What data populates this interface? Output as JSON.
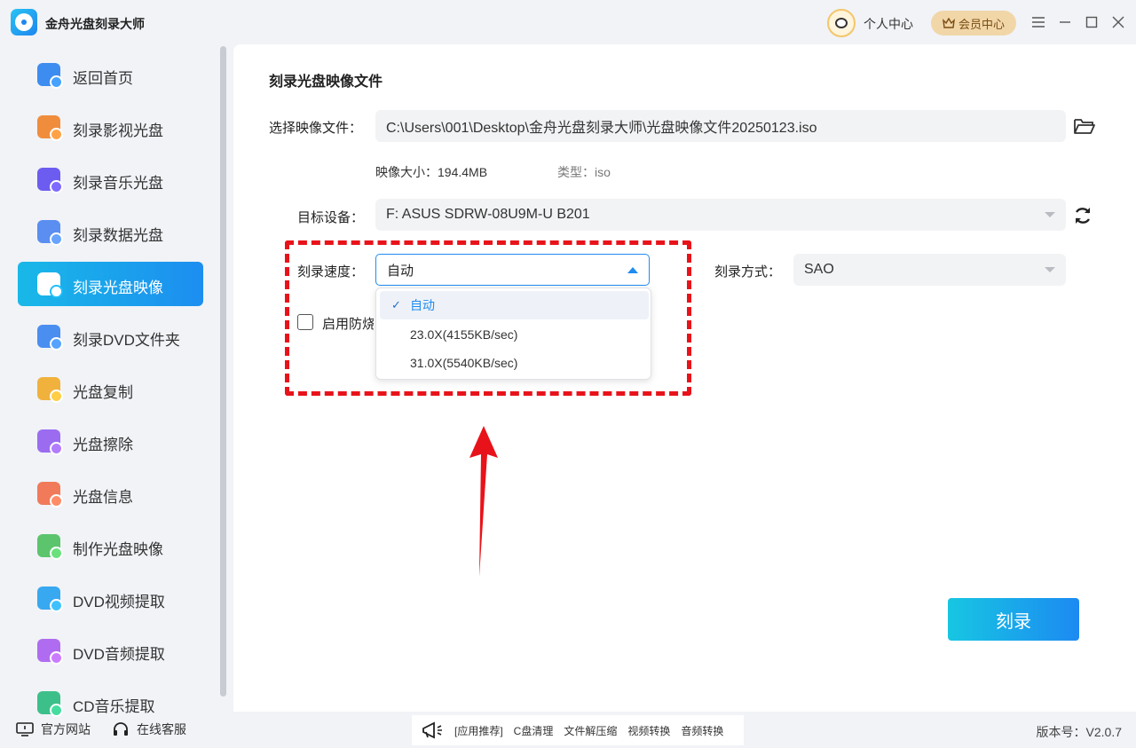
{
  "app": {
    "title": "金舟光盘刻录大师"
  },
  "header": {
    "user_center": "个人中心",
    "vip_center": "会员中心"
  },
  "sidebar": {
    "items": [
      {
        "label": "返回首页",
        "icon": "home-icon",
        "color": "#3d8cf0"
      },
      {
        "label": "刻录影视光盘",
        "icon": "video-disc-icon",
        "color": "#f08d3d"
      },
      {
        "label": "刻录音乐光盘",
        "icon": "music-disc-icon",
        "color": "#6d5cf0"
      },
      {
        "label": "刻录数据光盘",
        "icon": "data-disc-icon",
        "color": "#5a8ef0"
      },
      {
        "label": "刻录光盘映像",
        "icon": "disc-image-icon",
        "color": "#ffffff",
        "active": true
      },
      {
        "label": "刻录DVD文件夹",
        "icon": "dvd-folder-icon",
        "color": "#4a8ef0"
      },
      {
        "label": "光盘复制",
        "icon": "disc-copy-icon",
        "color": "#f0b23d"
      },
      {
        "label": "光盘擦除",
        "icon": "disc-erase-icon",
        "color": "#9b6cf0"
      },
      {
        "label": "光盘信息",
        "icon": "disc-info-icon",
        "color": "#f07a5a"
      },
      {
        "label": "制作光盘映像",
        "icon": "make-image-icon",
        "color": "#5cc46d"
      },
      {
        "label": "DVD视频提取",
        "icon": "dvd-video-extract-icon",
        "color": "#38a8f0"
      },
      {
        "label": "DVD音频提取",
        "icon": "dvd-audio-extract-icon",
        "color": "#b06cf0"
      },
      {
        "label": "CD音乐提取",
        "icon": "cd-music-extract-icon",
        "color": "#3dbf8a"
      }
    ]
  },
  "footer": {
    "website": "官方网站",
    "support": "在线客服",
    "links": [
      "[应用推荐]",
      "C盘清理",
      "文件解压缩",
      "视频转换",
      "音频转换"
    ],
    "version": "版本号：V2.0.7"
  },
  "main": {
    "title": "刻录光盘映像文件",
    "file_label": "选择映像文件：",
    "file_path": "C:\\Users\\001\\Desktop\\金舟光盘刻录大师\\光盘映像文件20250123.iso",
    "size_key": "映像大小：",
    "size_value": "194.4MB",
    "type_key": "类型：",
    "type_value": "iso",
    "device_label": "目标设备：",
    "device_value": "F: ASUS SDRW-08U9M-U B201",
    "speed_label": "刻录速度：",
    "speed_value": "自动",
    "speed_options": [
      "自动",
      "23.0X(4155KB/sec)",
      "31.0X(5540KB/sec)"
    ],
    "mode_label": "刻录方式：",
    "mode_value": "SAO",
    "checkbox_label": "启用防烧",
    "burn_button": "刻录"
  },
  "colors": {
    "accent": "#1f8cf0",
    "highlight": "#e8131a"
  }
}
